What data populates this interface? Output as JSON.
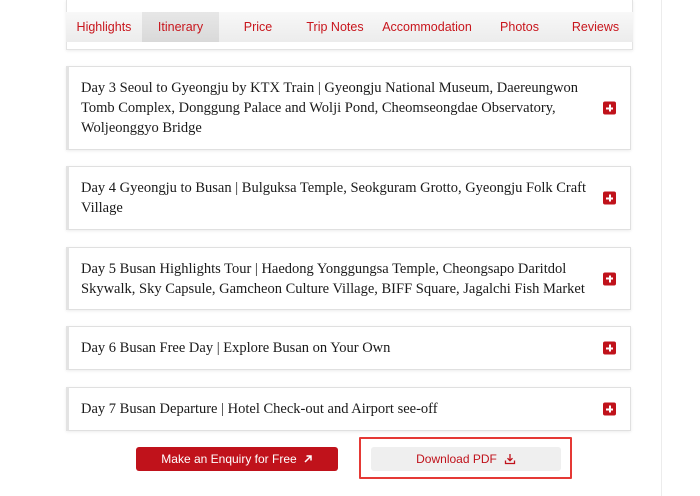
{
  "tabs": [
    {
      "label": "Highlights"
    },
    {
      "label": "Itinerary",
      "active": true
    },
    {
      "label": "Price"
    },
    {
      "label": "Trip Notes"
    },
    {
      "label": "Accommodation"
    },
    {
      "label": "Photos"
    },
    {
      "label": "Reviews"
    }
  ],
  "itinerary": [
    {
      "title": "Day 3 Seoul to Gyeongju by KTX Train | Gyeongju National Museum, Daereungwon Tomb Complex, Donggung Palace and Wolji Pond, Cheomseongdae Observatory, Woljeonggyo Bridge"
    },
    {
      "title": "Day 4 Gyeongju to Busan | Bulguksa Temple, Seokguram Grotto, Gyeongju Folk Craft Village"
    },
    {
      "title": "Day 5 Busan Highlights Tour | Haedong Yonggungsa Temple, Cheongsapo Daritdol Skywalk, Sky Capsule, Gamcheon Culture Village, BIFF Square, Jagalchi Fish Market"
    },
    {
      "title": "Day 6 Busan Free Day | Explore Busan on Your Own"
    },
    {
      "title": "Day 7 Busan Departure | Hotel Check-out and Airport see-off"
    }
  ],
  "actions": {
    "enquiry_label": "Make an Enquiry for Free",
    "download_label": "Download PDF"
  },
  "colors": {
    "accent": "#c0121b",
    "highlight": "#e53935"
  }
}
